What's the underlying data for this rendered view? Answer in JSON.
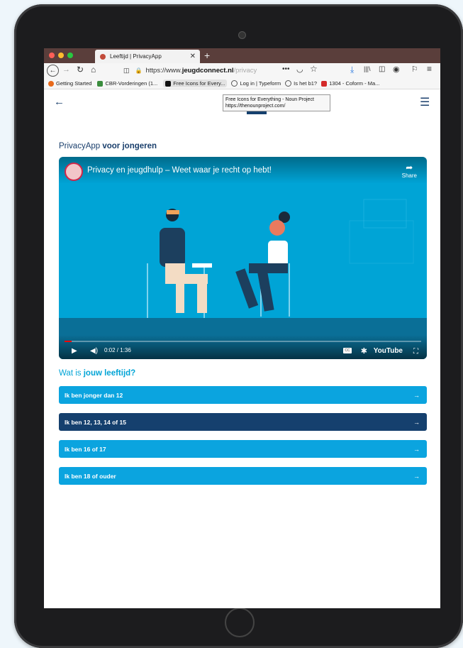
{
  "browser": {
    "tab_title": "Leeftijd | PrivacyApp",
    "tab_close": "✕",
    "new_tab": "+",
    "url_prefix": "https://www.",
    "url_domain": "jeugdconnect.nl",
    "url_path": "/privacy",
    "bookmarks": [
      {
        "label": "Getting Started",
        "color": "#e86a1b"
      },
      {
        "label": "CBR-Vorderingen (1...",
        "color": "#3b8d3e"
      },
      {
        "label": "Free Icons for Every...",
        "color": "#111111"
      },
      {
        "label": "Log in | Typeform",
        "color": "#ffffff"
      },
      {
        "label": "Is het b1?",
        "color": "#ffffff"
      },
      {
        "label": "1304 - Coform - Ma...",
        "color": "#d42a2a"
      }
    ],
    "tooltip_line1": "Free Icons for Everything - Noun Project",
    "tooltip_line2": "https://thenounproject.com/"
  },
  "page": {
    "heading_prefix": "PrivacyApp ",
    "heading_bold": "voor jongeren",
    "video": {
      "title": "Privacy en jeugdhulp – Weet waar je recht op hebt!",
      "share_label": "Share",
      "time": "0:02 / 1:36",
      "progress": 0.02,
      "cc_label": "CC",
      "brand": "YouTube"
    },
    "question_prefix": "Wat is ",
    "question_bold": "jouw leeftijd?",
    "options": [
      {
        "label": "Ik ben jonger dan 12",
        "active": false
      },
      {
        "label": "Ik ben 12, 13, 14 of 15",
        "active": true
      },
      {
        "label": "Ik ben 16 of 17",
        "active": false
      },
      {
        "label": "Ik ben 18 of ouder",
        "active": false
      }
    ],
    "option_arrow": "→"
  },
  "colors": {
    "primary": "#0ba4df",
    "dark": "#15406e",
    "video_bg": "#00a4d6"
  }
}
